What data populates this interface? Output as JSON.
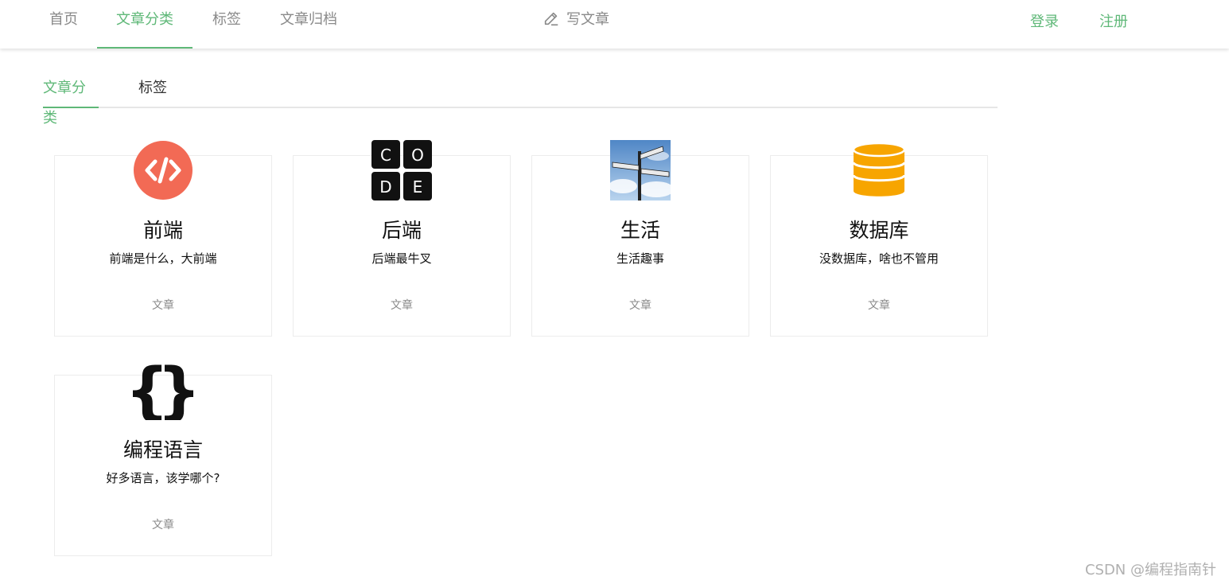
{
  "nav": {
    "home": "首页",
    "category": "文章分类",
    "tags": "标签",
    "archive": "文章归档",
    "write": "写文章",
    "login": "登录",
    "register": "注册",
    "accent_color": "#5fb878"
  },
  "subtabs": {
    "category": "文章分类",
    "tags": "标签"
  },
  "cards": [
    {
      "title": "前端",
      "desc": "前端是什么，大前端",
      "meta": "文章",
      "icon": "code-brackets-icon"
    },
    {
      "title": "后端",
      "desc": "后端最牛叉",
      "meta": "文章",
      "icon": "code-blocks-icon"
    },
    {
      "title": "生活",
      "desc": "生活趣事",
      "meta": "文章",
      "icon": "signpost-photo-icon"
    },
    {
      "title": "数据库",
      "desc": "没数据库，啥也不管用",
      "meta": "文章",
      "icon": "database-icon"
    },
    {
      "title": "编程语言",
      "desc": "好多语言，该学哪个?",
      "meta": "文章",
      "icon": "curly-braces-icon"
    }
  ],
  "watermark": "CSDN @编程指南针"
}
